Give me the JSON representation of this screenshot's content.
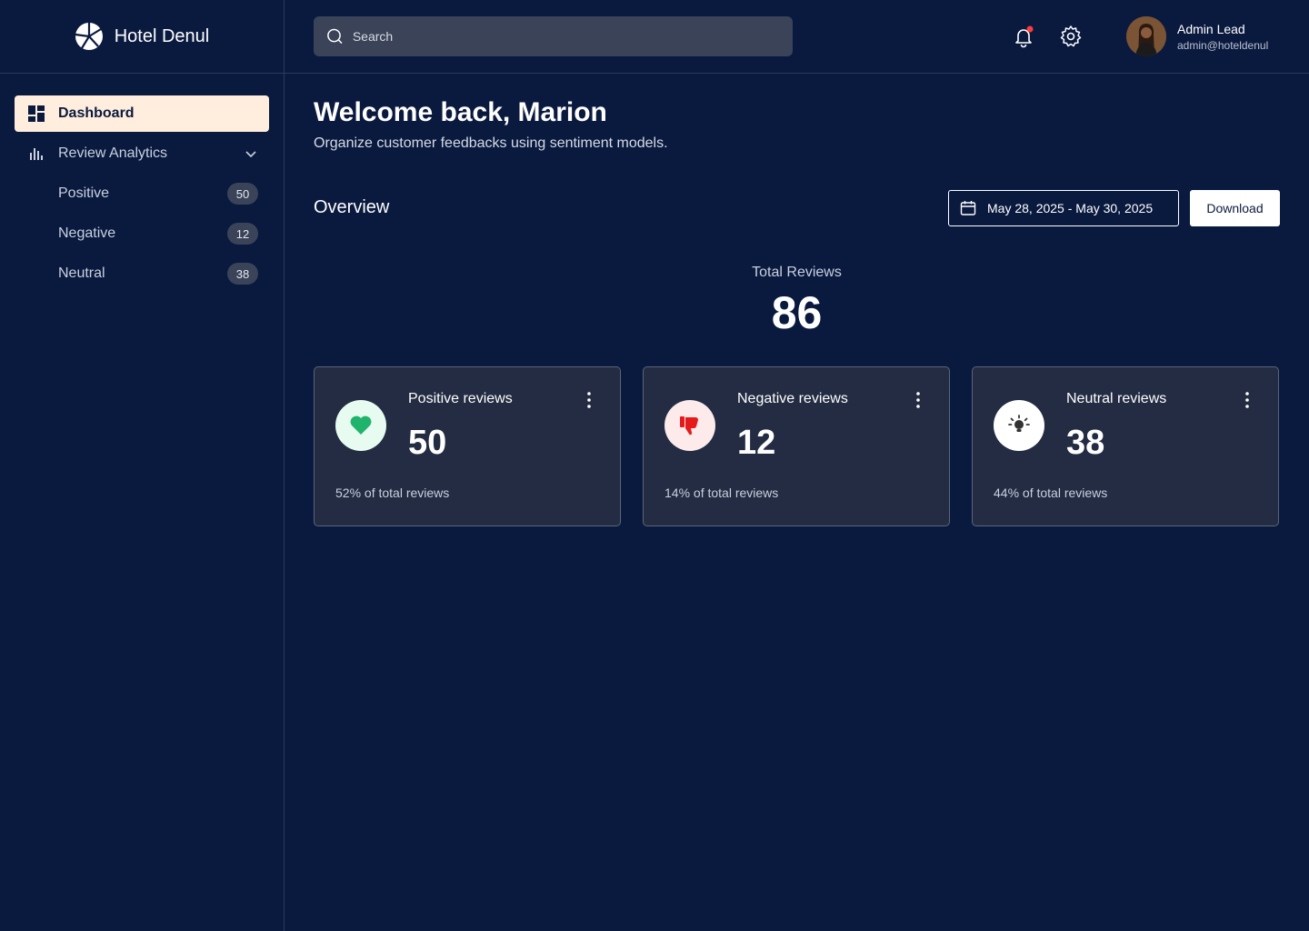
{
  "brand": {
    "name": "Hotel Denul"
  },
  "sidebar": {
    "items": [
      {
        "label": "Dashboard",
        "icon": "dashboard-icon"
      },
      {
        "label": "Review Analytics",
        "icon": "bar-chart-icon"
      },
      {
        "label": "Positive",
        "count": "50"
      },
      {
        "label": "Negative",
        "count": "12"
      },
      {
        "label": "Neutral",
        "count": "38"
      }
    ]
  },
  "header": {
    "search_placeholder": "Search",
    "user": {
      "name": "Admin Lead",
      "email": "admin@hoteldenul"
    },
    "notification_dot_color": "#ff3b3b"
  },
  "main": {
    "welcome": "Welcome back, Marion",
    "subtitle": "Organize customer feedbacks using sentiment models.",
    "overview_title": "Overview",
    "date_range": "May 28, 2025 - May 30, 2025",
    "download_label": "Download",
    "total_label": "Total Reviews",
    "total_value": "86",
    "cards": [
      {
        "title": "Positive reviews",
        "value": "50",
        "pct": "52% of total reviews",
        "icon": "heart-icon",
        "icon_bg": "#e8fbf1",
        "icon_color": "#1fb36b"
      },
      {
        "title": "Negative reviews",
        "value": "12",
        "pct": "14% of total reviews",
        "icon": "thumbs-down-icon",
        "icon_bg": "#fdeaea",
        "icon_color": "#e51b1b"
      },
      {
        "title": "Neutral reviews",
        "value": "38",
        "pct": "44% of total reviews",
        "icon": "lightbulb-icon",
        "icon_bg": "#ffffff",
        "icon_color": "#333333"
      }
    ]
  },
  "colors": {
    "background": "#0a1a3f",
    "card_bg": "#232c42",
    "active_nav_bg": "#ffeedd",
    "badge_bg": "#3a4358"
  }
}
